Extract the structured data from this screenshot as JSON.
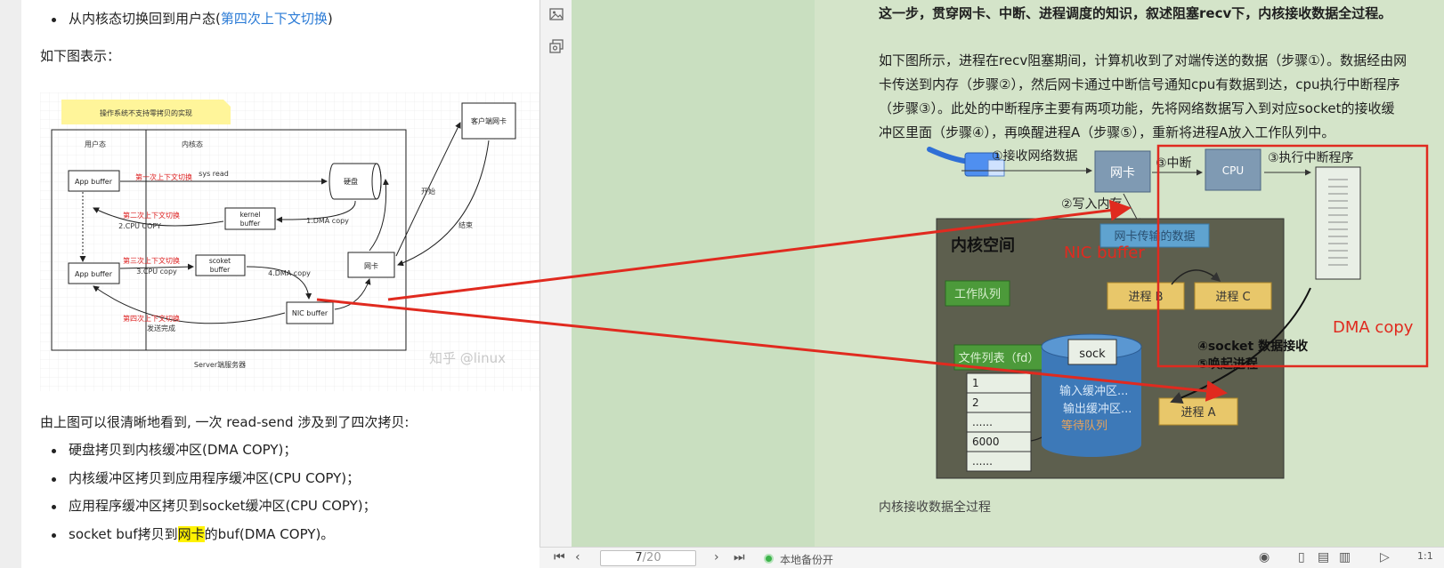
{
  "article": {
    "bullet_top_prefix": "从内核态切换回到用户态(",
    "bullet_top_link": "第四次上下文切换",
    "bullet_top_suffix": ")",
    "figure_intro": "如下图表示：",
    "summary": "由上图可以很清晰地看到, 一次 read-send 涉及到了四次拷贝:",
    "copies": [
      "硬盘拷贝到内核缓冲区(DMA COPY)；",
      "内核缓冲区拷贝到应用程序缓冲区(CPU COPY)；",
      "应用程序缓冲区拷贝到socket缓冲区(CPU COPY)；"
    ],
    "last_copy_prefix": "socket buf拷贝到",
    "last_copy_highlight": "网卡",
    "last_copy_suffix": "的buf(DMA COPY)。"
  },
  "left_diagram": {
    "note": "操作系统不支持零拷贝的实现",
    "user_mode": "用户态",
    "kernel_mode": "内核态",
    "app_buffer_1": "App buffer",
    "app_buffer_2": "App buffer",
    "ctx1": "第一次上下文切换",
    "sys_read": "sys read",
    "disk": "硬盘",
    "ctx2": "第二次上下文切换",
    "cpu_copy_2": "2.CPU COPY",
    "kernel_buffer_1": "kernel",
    "kernel_buffer_2": "buffer",
    "dma_copy_1": "1.DMA copy",
    "ctx3": "第三次上下文切换",
    "cpu_copy_3": "3.CPU copy",
    "socket_buffer_1": "scoket",
    "socket_buffer_2": "buffer",
    "dma_copy_4": "4.DMA copy",
    "nic": "网卡",
    "nic_buffer": "NIC buffer",
    "ctx4": "第四次上下文切换",
    "send_done": "发送完成",
    "client_nic": "客户端网卡",
    "start": "开始",
    "end": "结束",
    "server": "Server端服务器",
    "watermark": "知乎 @linux"
  },
  "reader": {
    "line_1": "这一步，贯穿网卡、中断、进程调度的知识，叙述阻塞recv下，内核接收数据全过程。",
    "para_lines": [
      "如下图所示，进程在recv阻塞期间，计算机收到了对端传送的数据（步骤①）。数据经由网",
      "卡传送到内存（步骤②），然后网卡通过中断信号通知cpu有数据到达，cpu执行中断程序",
      "（步骤③）。此处的中断程序主要有两项功能，先将网络数据写入到对应socket的接收缓",
      "冲区里面（步骤④），再唤醒进程A（步骤⑤），重新将进程A放入工作队列中。"
    ],
    "caption": "内核接收数据全过程"
  },
  "right_diagram": {
    "step1": "①接收网络数据",
    "nic": "网卡",
    "step3_irq": "③中断",
    "cpu": "CPU",
    "step3_exec": "③执行中断程序",
    "step2": "②写入内存",
    "kernel_space": "内核空间",
    "nic_data": "网卡传输的数据",
    "work_queue": "工作队列",
    "proc_b": "进程 B",
    "proc_c": "进程 C",
    "fd_list": "文件列表（fd）",
    "fd_rows": [
      "1",
      "2",
      "......",
      "6000",
      "......"
    ],
    "sock": "sock",
    "in_buf": "输入缓冲区...",
    "out_buf": "输出缓冲区...",
    "wait_queue": "等待队列",
    "step4": "④socket 数据接收",
    "step5": "⑤唤起进程",
    "proc_a": "进程 A",
    "note_nic_buffer": "NIC buffer",
    "note_dma": "DMA   copy"
  },
  "toolbar": {
    "page_current": "7",
    "page_total": "/20",
    "backup_status": "本地备份开"
  },
  "colors": {
    "annotation_red": "#e02a1f",
    "reader_bg": "#c9dfc0",
    "page_bg": "#d4e4c9",
    "kernel_box": "#5d5f4e",
    "nic_box": "#7f9ab3",
    "proc_box": "#e8c76a",
    "work_queue_box": "#4c9a3a",
    "sock_cylinder": "#3d79b8"
  }
}
